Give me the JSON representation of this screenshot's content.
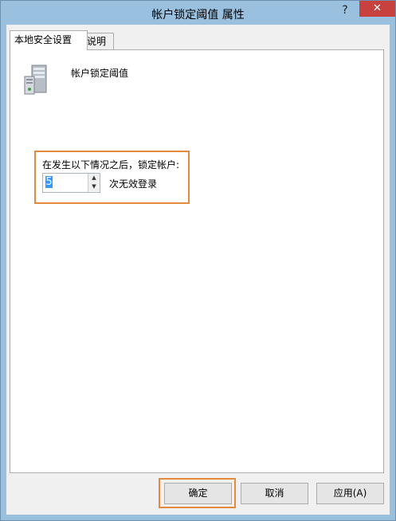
{
  "window": {
    "title": "帐户锁定阈值 属性",
    "help_label": "?",
    "close_label": "✕"
  },
  "tabs": [
    {
      "label": "本地安全设置",
      "active": true
    },
    {
      "label": "说明",
      "active": false
    }
  ],
  "policy": {
    "icon": "server-icon",
    "name": "帐户锁定阈值"
  },
  "threshold": {
    "prompt": "在发生以下情况之后，锁定帐户:",
    "value": "5",
    "unit": "次无效登录"
  },
  "buttons": {
    "ok": "确定",
    "cancel": "取消",
    "apply": "应用(A)"
  },
  "colors": {
    "frame": "#99c0de",
    "close": "#c7423f",
    "highlight": "#e38a3d",
    "selection": "#3399ff"
  }
}
